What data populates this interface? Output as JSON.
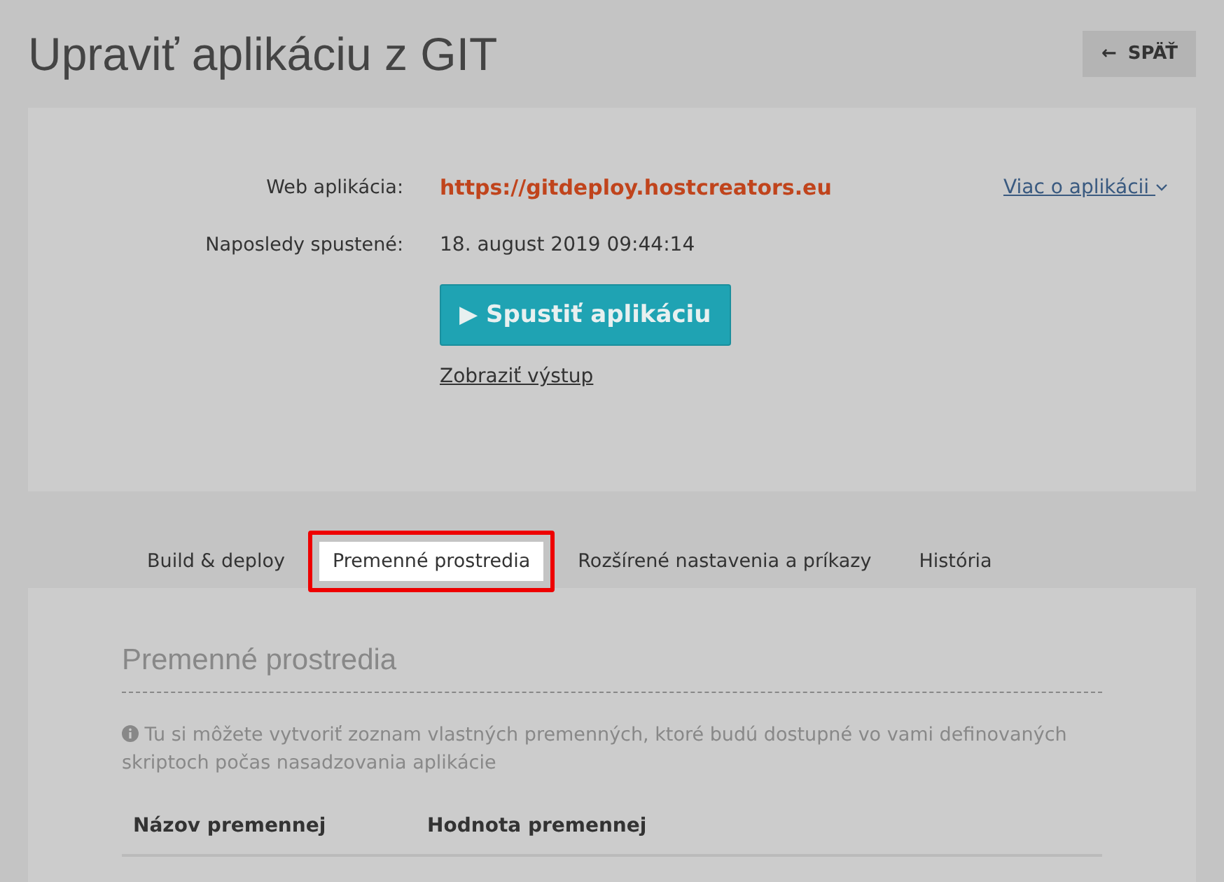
{
  "title": "Upraviť aplikáciu z GIT",
  "back_button": {
    "icon": "←",
    "label": "SPÄŤ"
  },
  "app_info": {
    "fields": [
      {
        "label": "Web aplikácia:",
        "value": "https://gitdeploy.hostcreators.eu",
        "kind": "link"
      },
      {
        "label": "Naposledy spustené:",
        "value": "18. august 2019 09:44:14",
        "kind": "text"
      }
    ],
    "more_link": "Viac o aplikácii",
    "run_button": {
      "icon": "▶",
      "label": "Spustiť aplikáciu"
    },
    "output_link": "Zobraziť výstup"
  },
  "tabs": [
    {
      "label": "Build & deploy",
      "selected": false,
      "highlighted": false
    },
    {
      "label": "Premenné prostredia",
      "selected": true,
      "highlighted": true
    },
    {
      "label": "Rozšírené nastavenia a príkazy",
      "selected": false,
      "highlighted": false
    },
    {
      "label": "História",
      "selected": false,
      "highlighted": false
    }
  ],
  "section": {
    "heading": "Premenné prostredia",
    "info": "Tu si môžete vytvoriť zoznam vlastných premenných, ktoré budú dostupné vo vami definovaných skriptoch počas nasadzovania aplikácie",
    "table": {
      "columns": [
        "Názov premennej",
        "Hodnota premennej"
      ]
    }
  }
}
